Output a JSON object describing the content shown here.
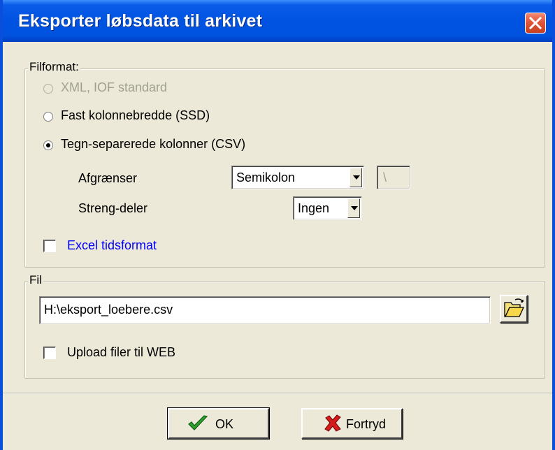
{
  "window": {
    "title": "Eksporter løbsdata til arkivet"
  },
  "filformat": {
    "label": "Filformat:",
    "options": [
      {
        "label": "XML, IOF standard",
        "selected": false,
        "enabled": false
      },
      {
        "label": "Fast kolonnebredde (SSD)",
        "selected": false,
        "enabled": true
      },
      {
        "label": "Tegn-separerede kolonner (CSV)",
        "selected": true,
        "enabled": true
      }
    ],
    "afgraenser": {
      "label": "Afgrænser",
      "value": "Semikolon",
      "custom_value": "\\"
    },
    "strengdeler": {
      "label": "Streng-deler",
      "value": "Ingen"
    },
    "excel": {
      "label": "Excel tidsformat",
      "checked": false
    }
  },
  "fil": {
    "label": "Fil",
    "path": "H:\\eksport_loebere.csv",
    "upload": {
      "label": "Upload filer til WEB",
      "checked": false
    }
  },
  "buttons": {
    "ok": "OK",
    "cancel": "Fortryd"
  },
  "colors": {
    "titlebar": "#0053e1",
    "link_blue": "#0000ff",
    "dialog_bg": "#ece9d8"
  }
}
